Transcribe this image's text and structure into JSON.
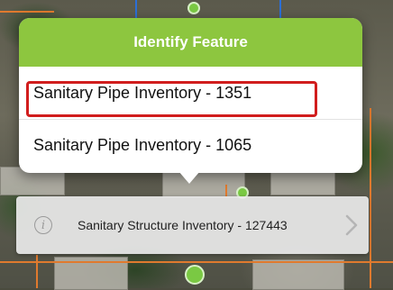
{
  "popover": {
    "title": "Identify Feature",
    "results": [
      {
        "label": "Sanitary Pipe Inventory - 1351",
        "highlighted": true
      },
      {
        "label": "Sanitary Pipe Inventory - 1065",
        "highlighted": false
      }
    ],
    "header_color": "#8dc63f",
    "highlight_color": "#d11d1d"
  },
  "callout": {
    "label": "Sanitary Structure Inventory - 127443",
    "info_icon": "info-circle-icon",
    "chevron_icon": "chevron-right-icon"
  },
  "map": {
    "pipe_color": "#e07a2e",
    "node_color": "#7ac943"
  }
}
